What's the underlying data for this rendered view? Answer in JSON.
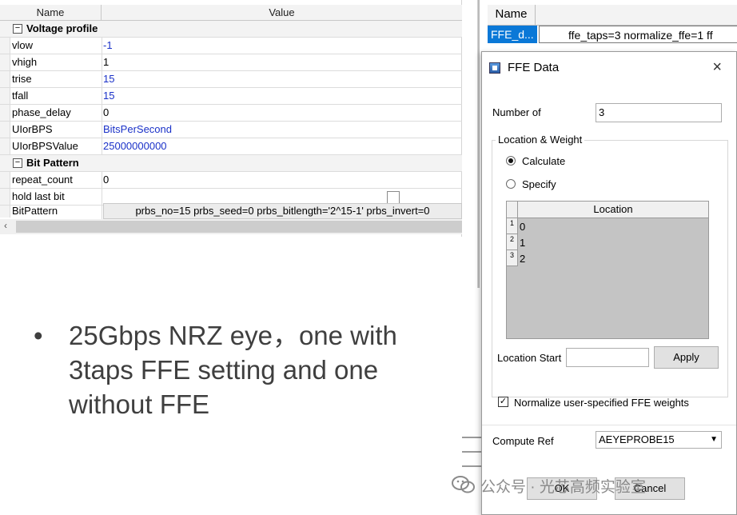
{
  "property_grid": {
    "header": {
      "name_col": "Name",
      "value_col": "Value"
    },
    "categories": [
      {
        "label": "Voltage profile",
        "toggle": "−"
      },
      {
        "label": "Bit Pattern",
        "toggle": "−"
      }
    ],
    "voltage_rows": [
      {
        "name": "vlow",
        "value": "-1"
      },
      {
        "name": "vhigh",
        "value": "1"
      },
      {
        "name": "trise",
        "value": "15"
      },
      {
        "name": "tfall",
        "value": "15"
      },
      {
        "name": "phase_delay",
        "value": "0"
      },
      {
        "name": "UIorBPS",
        "value": "BitsPerSecond"
      },
      {
        "name": "UIorBPSValue",
        "value": "25000000000"
      }
    ],
    "bit_rows": [
      {
        "name": "repeat_count",
        "value": "0"
      },
      {
        "name": "hold last bit",
        "value": ""
      },
      {
        "name": "BitPattern",
        "value": "prbs_no=15 prbs_seed=0 prbs_bitlength='2^15-1' prbs_invert=0"
      }
    ],
    "scroll_arrow": "‹"
  },
  "slide": {
    "bullet": "•",
    "text": "25Gbps NRZ eye，one with 3taps FFE setting and one without FFE"
  },
  "background_window": {
    "header": "Name",
    "row_name": "FFE_d...",
    "row_value": "ffe_taps=3 normalize_ffe=1 ff"
  },
  "dialog": {
    "title": "FFE Data",
    "close": "×",
    "number_of_label": "Number of",
    "number_of_value": "3",
    "group_label": "Location & Weight",
    "radio_calculate": "Calculate",
    "radio_specify": "Specify",
    "table": {
      "column": "Location",
      "rows": [
        {
          "index": "1",
          "value": "0"
        },
        {
          "index": "2",
          "value": "1"
        },
        {
          "index": "3",
          "value": "2"
        }
      ]
    },
    "location_start_label": "Location Start",
    "location_start_value": "",
    "apply_label": "Apply",
    "normalize_label": "Normalize user-specified FFE weights",
    "normalize_check": "✓",
    "compute_ref_label": "Compute Ref",
    "compute_ref_value": "AEYEPROBE15",
    "ok_label": "OK",
    "cancel_label": "Cancel"
  },
  "watermark": {
    "text": "公众号 · 光芯高频实验室"
  },
  "colors": {
    "selection": "#0a78d7",
    "value_blue": "#1a31c8",
    "slide_text": "#3f3f3f"
  }
}
